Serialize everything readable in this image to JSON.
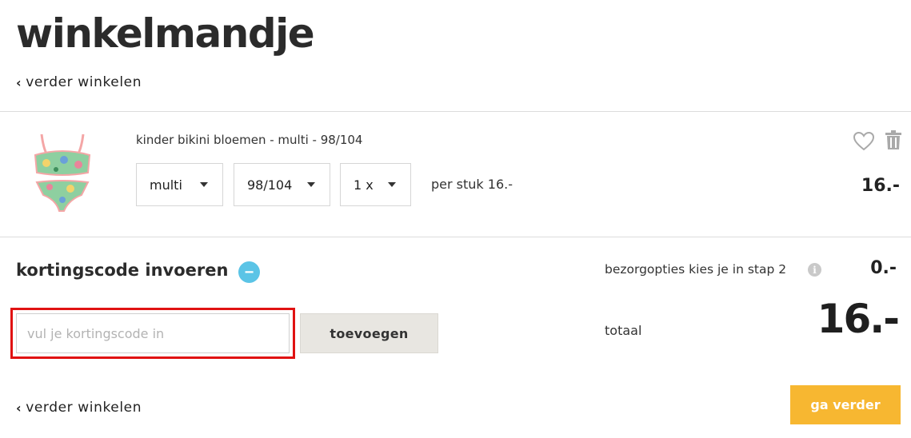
{
  "page": {
    "title": "winkelmandje",
    "back_link_label": "verder winkelen"
  },
  "cart_item": {
    "name": "kinder bikini bloemen - multi - 98/104",
    "color_select": "multi",
    "size_select": "98/104",
    "quantity_select": "1 x",
    "per_piece": "per stuk 16.-",
    "price": "16.-",
    "icons": {
      "favorite": "heart-icon",
      "delete": "trash-icon"
    }
  },
  "discount": {
    "title": "kortingscode invoeren",
    "toggle_symbol": "−",
    "input_placeholder": "vul je kortingscode in",
    "input_value": "",
    "add_button_label": "toevoegen",
    "highlight_color": "#e01212"
  },
  "summary": {
    "delivery_label": "bezorgopties kies je in stap 2",
    "delivery_info_symbol": "i",
    "delivery_price": "0.-",
    "total_label": "totaal",
    "total_price": "16.-"
  },
  "footer": {
    "back_link_label": "verder winkelen",
    "continue_button_label": "ga verder"
  },
  "colors": {
    "accent_blue": "#5bc4e6",
    "continue_button": "#f7b731",
    "add_button_bg": "#e8e6e1"
  }
}
